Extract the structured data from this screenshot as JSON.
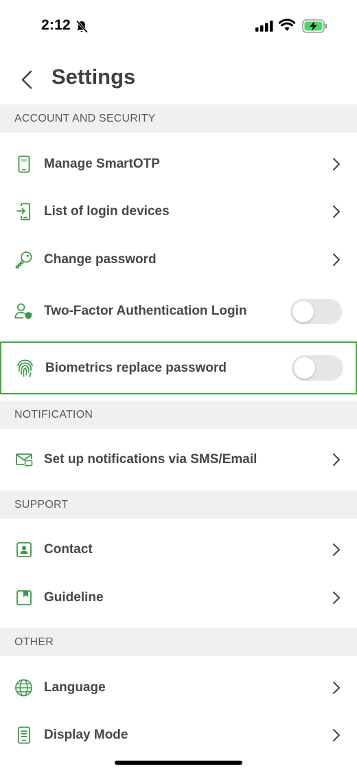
{
  "status_bar": {
    "time": "2:12"
  },
  "header": {
    "title": "Settings"
  },
  "colors": {
    "accent": "#3a9a4a",
    "highlight_border": "#3daa3d",
    "section_bg": "#f0f0f0",
    "toggle_off": "#e6e6e6"
  },
  "sections": {
    "account": {
      "title": "ACCOUNT AND SECURITY",
      "items": [
        {
          "label": "Manage SmartOTP",
          "icon": "phone-icon",
          "control": "chevron"
        },
        {
          "label": "List of login devices",
          "icon": "device-login-icon",
          "control": "chevron"
        },
        {
          "label": "Change password",
          "icon": "key-icon",
          "control": "chevron"
        },
        {
          "label": "Two-Factor Authentication Login",
          "icon": "user-shield-icon",
          "control": "toggle",
          "enabled": false
        },
        {
          "label": "Biometrics replace password",
          "icon": "fingerprint-icon",
          "control": "toggle",
          "enabled": false,
          "highlighted": true
        }
      ]
    },
    "notification": {
      "title": "NOTIFICATION",
      "items": [
        {
          "label": "Set up notifications via SMS/Email",
          "icon": "mail-icon",
          "control": "chevron"
        }
      ]
    },
    "support": {
      "title": "SUPPORT",
      "items": [
        {
          "label": "Contact",
          "icon": "contact-icon",
          "control": "chevron"
        },
        {
          "label": "Guideline",
          "icon": "bookmark-icon",
          "control": "chevron"
        }
      ]
    },
    "other": {
      "title": "OTHER",
      "items": [
        {
          "label": "Language",
          "icon": "globe-icon",
          "control": "chevron"
        },
        {
          "label": "Display Mode",
          "icon": "display-icon",
          "control": "chevron"
        }
      ]
    }
  }
}
